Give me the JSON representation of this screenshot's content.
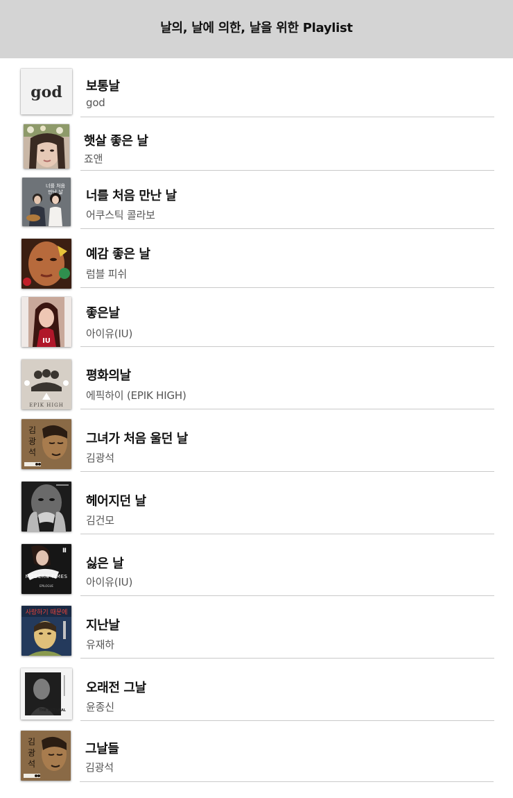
{
  "header": {
    "title": "날의, 날에 의한, 날을 위한 Playlist"
  },
  "playlist": [
    {
      "title": "보통날",
      "artist": "god",
      "art_icon": "album-art-god",
      "art_text": "god"
    },
    {
      "title": "햇살 좋은 날",
      "artist": "죠앤",
      "art_icon": "album-art-portrait"
    },
    {
      "title": "너를 처음 만난 날",
      "artist": "어쿠스틱 콜라보",
      "art_icon": "album-art-duo"
    },
    {
      "title": "예감 좋은 날",
      "artist": "럼블 피쉬",
      "art_icon": "album-art-face"
    },
    {
      "title": "좋은날",
      "artist": "아이유(IU)",
      "art_icon": "album-art-iu",
      "art_text": "IU"
    },
    {
      "title": "평화의날",
      "artist": "에픽하이 (EPIK HIGH)",
      "art_icon": "album-art-epik-high",
      "art_text": "EPIK HIGH"
    },
    {
      "title": "그녀가 처음 울던 날",
      "artist": "김광석",
      "art_icon": "album-art-kim-kwangseok",
      "art_text": "김광석"
    },
    {
      "title": "헤어지던 날",
      "artist": "김건모",
      "art_icon": "album-art-bw-portrait"
    },
    {
      "title": "싫은 날",
      "artist": "아이유(IU)",
      "art_icon": "album-art-modern-times",
      "art_text": "MODERN TIMES"
    },
    {
      "title": "지난날",
      "artist": "유재하",
      "art_icon": "album-art-yoo-jaeha",
      "art_text": "사랑하기 때문에"
    },
    {
      "title": "오래전 그날",
      "artist": "윤종신",
      "art_icon": "album-art-the-natural",
      "art_text": "THE NATURAL"
    },
    {
      "title": "그날들",
      "artist": "김광석",
      "art_icon": "album-art-kim-kwangseok",
      "art_text": "김광석"
    }
  ]
}
